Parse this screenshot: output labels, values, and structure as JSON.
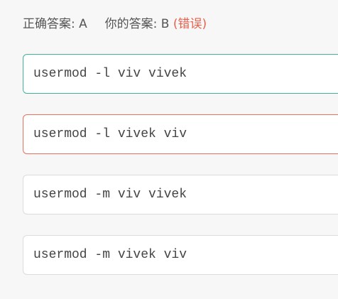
{
  "header": {
    "correct_label": "正确答案:",
    "correct_value": "A",
    "your_label": "你的答案:",
    "your_value": "B",
    "result": "(错误)"
  },
  "options": [
    {
      "key": "A",
      "text": "usermod -l viv vivek",
      "state": "correct"
    },
    {
      "key": "B",
      "text": "usermod -l vivek viv",
      "state": "wrong"
    },
    {
      "key": "C",
      "text": "usermod -m viv vivek",
      "state": "neutral"
    },
    {
      "key": "D",
      "text": "usermod -m vivek viv",
      "state": "neutral"
    }
  ],
  "colors": {
    "correct_border": "#3fb39b",
    "wrong_border": "#e8705e",
    "result_wrong": "#e8604c",
    "neutral_border": "#dcdcdc",
    "background": "#f7f7f7"
  }
}
